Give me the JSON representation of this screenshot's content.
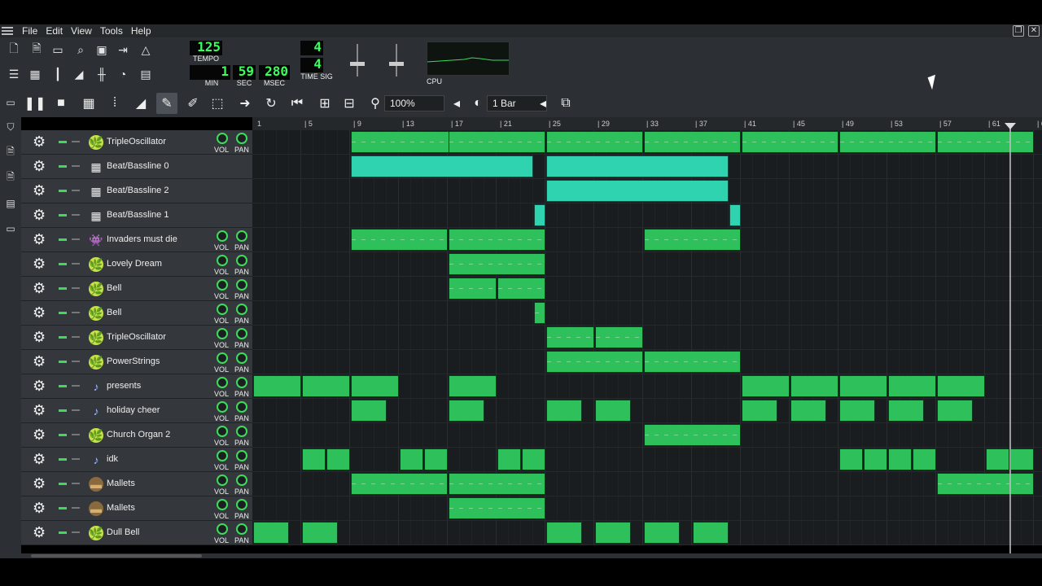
{
  "menu": [
    "File",
    "Edit",
    "View",
    "Tools",
    "Help"
  ],
  "transport": {
    "tempo": "125",
    "tempo_label": "TEMPO",
    "min": "1",
    "min_label": "MIN",
    "sec": "59",
    "sec_label": "SEC",
    "msec": "280",
    "msec_label": "MSEC",
    "ts_num": "4",
    "ts_den": "4",
    "ts_label": "TIME SIG",
    "cpu_label": "CPU"
  },
  "editor": {
    "zoom": "100%",
    "quantize": "1 Bar"
  },
  "ruler": [
    "1",
    "5",
    "9",
    "13",
    "17",
    "21",
    "25",
    "29",
    "33",
    "37",
    "41",
    "45",
    "49",
    "53",
    "57",
    "61",
    "6"
  ],
  "knob_labels": {
    "vol": "VOL",
    "pan": "PAN"
  },
  "tracks": [
    {
      "name": "TripleOscillator",
      "icon": "leaf-icon",
      "vp": true,
      "clips": [
        [
          9,
          9,
          "g"
        ],
        [
          17,
          8,
          "g"
        ],
        [
          25,
          8,
          "g"
        ],
        [
          33,
          8,
          "g"
        ],
        [
          41,
          8,
          "g"
        ],
        [
          49,
          8,
          "g"
        ],
        [
          57,
          8,
          "g"
        ]
      ]
    },
    {
      "name": "Beat/Bassline 0",
      "icon": "grid-icon",
      "vp": false,
      "clips": [
        [
          9,
          15,
          "t"
        ],
        [
          25,
          15,
          "t"
        ]
      ]
    },
    {
      "name": "Beat/Bassline 2",
      "icon": "grid-icon",
      "vp": false,
      "clips": [
        [
          25,
          15,
          "t"
        ]
      ]
    },
    {
      "name": "Beat/Bassline 1",
      "icon": "grid-icon",
      "vp": false,
      "clips": [
        [
          24,
          1,
          "t"
        ],
        [
          40,
          1,
          "t"
        ]
      ]
    },
    {
      "name": "Invaders must die",
      "icon": "invader-icon",
      "vp": true,
      "clips": [
        [
          9,
          8,
          "g"
        ],
        [
          17,
          8,
          "g"
        ],
        [
          33,
          8,
          "g"
        ]
      ]
    },
    {
      "name": "Lovely Dream",
      "icon": "leaf-icon",
      "vp": true,
      "clips": [
        [
          17,
          8,
          "g"
        ]
      ]
    },
    {
      "name": "Bell",
      "icon": "leaf-icon",
      "vp": true,
      "clips": [
        [
          17,
          4,
          "g"
        ],
        [
          21,
          4,
          "g"
        ]
      ]
    },
    {
      "name": "Bell",
      "icon": "leaf-icon",
      "vp": true,
      "clips": [
        [
          24,
          1,
          "g"
        ]
      ]
    },
    {
      "name": "TripleOscillator",
      "icon": "leaf-icon",
      "vp": true,
      "clips": [
        [
          25,
          4,
          "g"
        ],
        [
          29,
          4,
          "g"
        ]
      ]
    },
    {
      "name": "PowerStrings",
      "icon": "leaf-icon",
      "vp": true,
      "clips": [
        [
          25,
          8,
          "g"
        ],
        [
          33,
          8,
          "g"
        ]
      ]
    },
    {
      "name": "presents",
      "icon": "note-icon",
      "vp": true,
      "clips": [
        [
          1,
          4,
          "s"
        ],
        [
          5,
          4,
          "s"
        ],
        [
          9,
          4,
          "s"
        ],
        [
          17,
          4,
          "s"
        ],
        [
          41,
          4,
          "s"
        ],
        [
          45,
          4,
          "s"
        ],
        [
          49,
          4,
          "s"
        ],
        [
          53,
          4,
          "s"
        ],
        [
          57,
          4,
          "s"
        ]
      ]
    },
    {
      "name": "holiday cheer",
      "icon": "note-icon",
      "vp": true,
      "clips": [
        [
          9,
          3,
          "s"
        ],
        [
          17,
          3,
          "s"
        ],
        [
          25,
          3,
          "s"
        ],
        [
          29,
          3,
          "s"
        ],
        [
          41,
          3,
          "s"
        ],
        [
          45,
          3,
          "s"
        ],
        [
          49,
          3,
          "s"
        ],
        [
          53,
          3,
          "s"
        ],
        [
          57,
          3,
          "s"
        ]
      ]
    },
    {
      "name": "Church Organ 2",
      "icon": "leaf-icon",
      "vp": true,
      "clips": [
        [
          33,
          8,
          "g"
        ]
      ]
    },
    {
      "name": "idk",
      "icon": "note-icon",
      "vp": true,
      "clips": [
        [
          5,
          2,
          "s"
        ],
        [
          7,
          2,
          "s"
        ],
        [
          13,
          2,
          "s"
        ],
        [
          15,
          2,
          "s"
        ],
        [
          21,
          2,
          "s"
        ],
        [
          23,
          2,
          "s"
        ],
        [
          49,
          2,
          "s"
        ],
        [
          51,
          2,
          "s"
        ],
        [
          53,
          2,
          "s"
        ],
        [
          55,
          2,
          "s"
        ],
        [
          61,
          2,
          "s"
        ],
        [
          63,
          2,
          "s"
        ]
      ]
    },
    {
      "name": "Mallets",
      "icon": "mallet-icon",
      "vp": true,
      "clips": [
        [
          9,
          8,
          "g"
        ],
        [
          17,
          8,
          "g"
        ],
        [
          57,
          8,
          "g"
        ]
      ]
    },
    {
      "name": "Mallets",
      "icon": "mallet-icon",
      "vp": true,
      "clips": [
        [
          17,
          8,
          "g"
        ]
      ]
    },
    {
      "name": "Dull Bell",
      "icon": "leaf-icon",
      "vp": true,
      "clips": [
        [
          1,
          3,
          "s"
        ],
        [
          5,
          3,
          "s"
        ],
        [
          25,
          3,
          "s"
        ],
        [
          29,
          3,
          "s"
        ],
        [
          33,
          3,
          "s"
        ],
        [
          37,
          3,
          "s"
        ]
      ]
    }
  ]
}
